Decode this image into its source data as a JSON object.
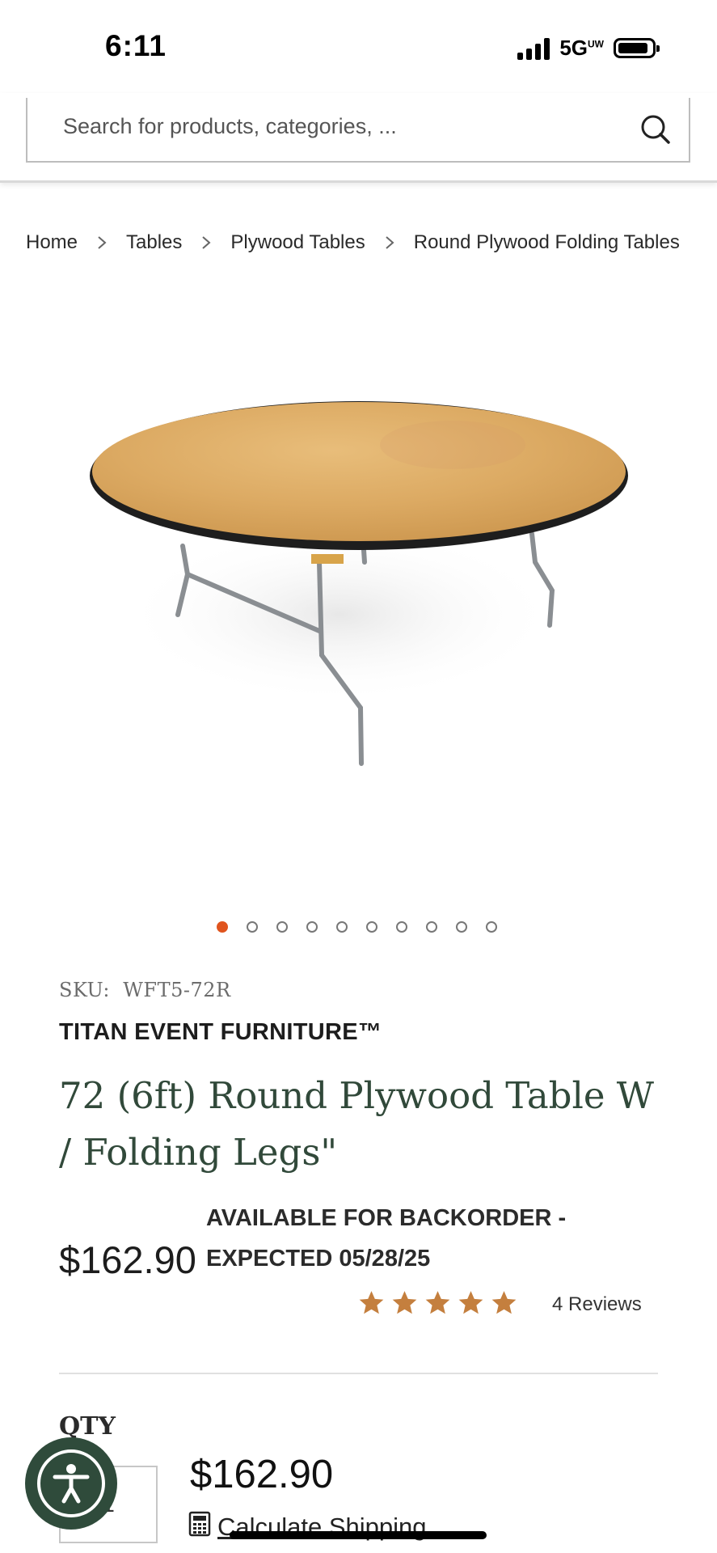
{
  "status_bar": {
    "time": "6:11",
    "network": "5G",
    "network_sup": "UW"
  },
  "search": {
    "placeholder": "Search for products, categories, ..."
  },
  "breadcrumb": [
    "Home",
    "Tables",
    "Plywood Tables",
    "Round Plywood Folding Tables"
  ],
  "product": {
    "sku_label": "SKU:",
    "sku": "WFT5-72R",
    "brand": "TITAN EVENT FURNITURE™",
    "title": "72 (6ft) Round Plywood Table W / Folding Legs\"",
    "price": "$162.90",
    "availability": "AVAILABLE FOR BACKORDER - EXPECTED 05/28/25",
    "rating": 5,
    "rating_max": 5,
    "reviews": "4 Reviews",
    "image_count": 10,
    "active_image": 1
  },
  "purchase": {
    "qty_label": "QTY",
    "qty_value": "1",
    "subtotal": "$162.90",
    "calculate_shipping": "Calculate Shipping"
  },
  "colors": {
    "accent": "#e0541e",
    "title_green": "#31493a",
    "star": "#c47f3e",
    "accessibility_bg": "#2f4b3b"
  },
  "icons": [
    "search-icon",
    "chevron-right-icon",
    "star-icon",
    "calculator-icon",
    "accessibility-icon"
  ]
}
